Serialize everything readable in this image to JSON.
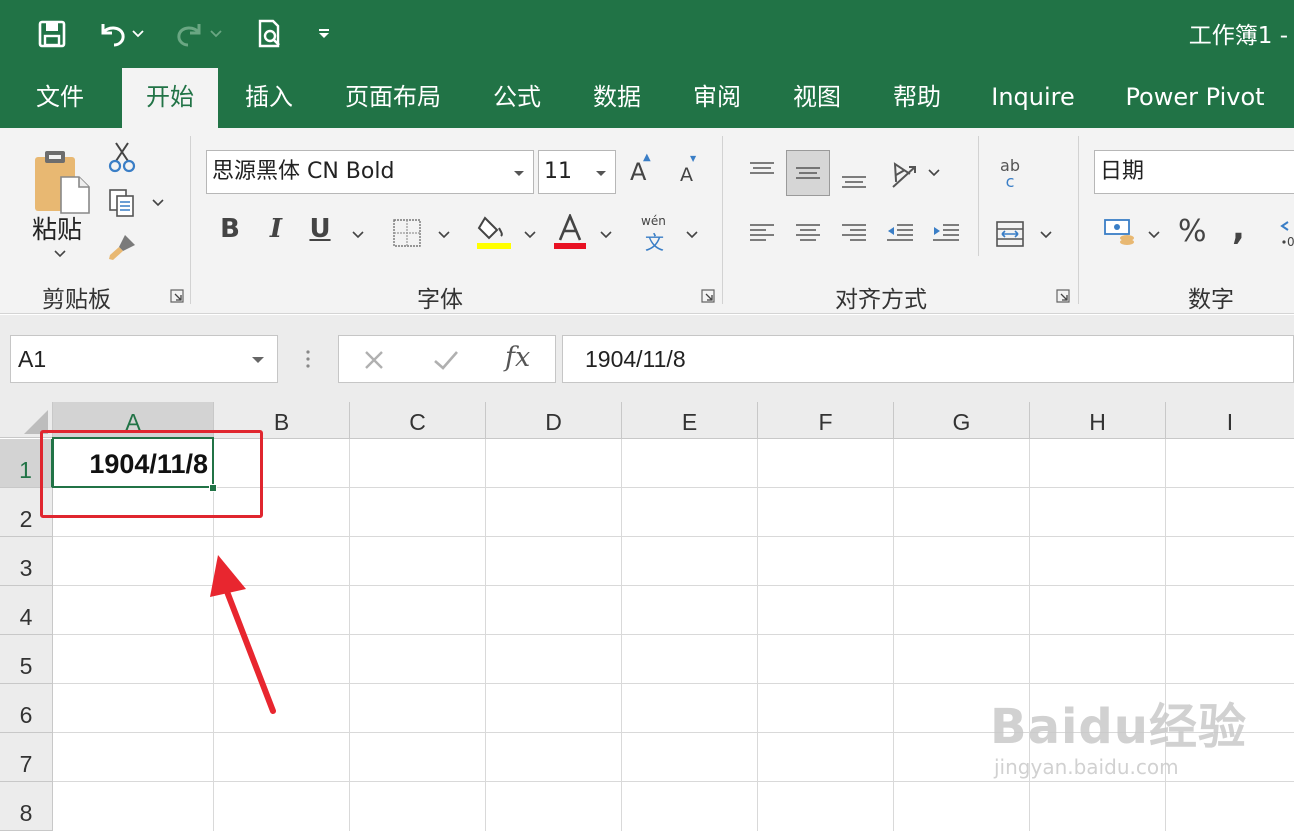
{
  "window": {
    "title": "工作簿1 -"
  },
  "ribbon_tabs": [
    {
      "label": "文件"
    },
    {
      "label": "开始",
      "active": true
    },
    {
      "label": "插入"
    },
    {
      "label": "页面布局"
    },
    {
      "label": "公式"
    },
    {
      "label": "数据"
    },
    {
      "label": "审阅"
    },
    {
      "label": "视图"
    },
    {
      "label": "帮助"
    },
    {
      "label": "Inquire"
    },
    {
      "label": "Power Pivot"
    }
  ],
  "clipboard": {
    "paste_label": "粘贴",
    "group_label": "剪贴板"
  },
  "font": {
    "name_value": "思源黑体 CN Bold",
    "size_value": "11",
    "bold": "B",
    "italic": "I",
    "underline": "U",
    "grow": "A",
    "shrink": "A",
    "phonetic_top": "wén",
    "phonetic_bottom": "文",
    "group_label": "字体",
    "highlight_color": "#ffff00",
    "font_color": "#e81123"
  },
  "alignment": {
    "wrap_top": "ab",
    "wrap_bottom": "c",
    "group_label": "对齐方式"
  },
  "number": {
    "format_value": "日期",
    "percent": "%",
    "comma": ",",
    "group_label": "数字"
  },
  "formula_bar": {
    "name_box": "A1",
    "fx": "fx",
    "formula": "1904/11/8"
  },
  "sheet": {
    "columns": [
      "A",
      "B",
      "C",
      "D",
      "E",
      "F",
      "G",
      "H",
      "I"
    ],
    "rows": [
      "1",
      "2",
      "3",
      "4",
      "5",
      "6",
      "7",
      "8"
    ],
    "cells": {
      "A1": "1904/11/8"
    },
    "selected_cell": "A1"
  },
  "annotation": {
    "highlight_color": "#e0262f"
  },
  "watermark": {
    "logo": "Baidu经验",
    "url": "jingyan.baidu.com"
  },
  "colors": {
    "accent": "#217346"
  }
}
